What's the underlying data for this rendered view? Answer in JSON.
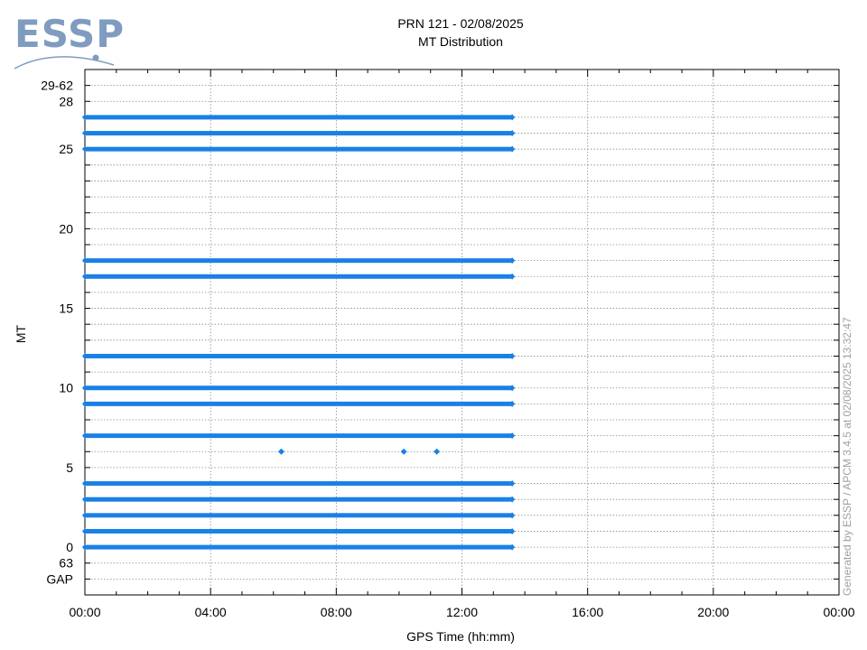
{
  "logo": {
    "text": "ESSP",
    "color": "#7f9cc0"
  },
  "chart_data": {
    "type": "scatter",
    "title": "PRN 121 - 02/08/2025",
    "subtitle": "MT Distribution",
    "xlabel": "GPS Time (hh:mm)",
    "ylabel": "MT",
    "x_ticks": [
      "00:00",
      "04:00",
      "08:00",
      "12:00",
      "16:00",
      "20:00",
      "00:00"
    ],
    "x_range_hours": [
      0,
      24
    ],
    "y_ticks": [
      {
        "label": "GAP",
        "value": -2
      },
      {
        "label": "63",
        "value": -1
      },
      {
        "label": "0",
        "value": 0
      },
      {
        "label": "5",
        "value": 5
      },
      {
        "label": "10",
        "value": 10
      },
      {
        "label": "15",
        "value": 15
      },
      {
        "label": "20",
        "value": 20
      },
      {
        "label": "25",
        "value": 25
      },
      {
        "label": "28",
        "value": 28
      },
      {
        "label": "29-62",
        "value": 29
      }
    ],
    "y_range": [
      -3,
      30
    ],
    "grid": true,
    "marker_color": "#1a80e6",
    "series": [
      {
        "mt": 0,
        "start_hour": 0.0,
        "end_hour": 13.6
      },
      {
        "mt": 1,
        "start_hour": 0.0,
        "end_hour": 13.6
      },
      {
        "mt": 2,
        "start_hour": 0.0,
        "end_hour": 13.6
      },
      {
        "mt": 3,
        "start_hour": 0.0,
        "end_hour": 13.6
      },
      {
        "mt": 4,
        "start_hour": 0.0,
        "end_hour": 13.6
      },
      {
        "mt": 7,
        "start_hour": 0.0,
        "end_hour": 13.6
      },
      {
        "mt": 9,
        "start_hour": 0.0,
        "end_hour": 13.6
      },
      {
        "mt": 10,
        "start_hour": 0.0,
        "end_hour": 13.6
      },
      {
        "mt": 12,
        "start_hour": 0.0,
        "end_hour": 13.6
      },
      {
        "mt": 17,
        "start_hour": 0.0,
        "end_hour": 13.6
      },
      {
        "mt": 18,
        "start_hour": 0.0,
        "end_hour": 13.6
      },
      {
        "mt": 25,
        "start_hour": 0.0,
        "end_hour": 13.6
      },
      {
        "mt": 26,
        "start_hour": 0.0,
        "end_hour": 13.6
      },
      {
        "mt": 27,
        "start_hour": 0.0,
        "end_hour": 13.6
      }
    ],
    "points": [
      {
        "mt": 6,
        "hour": 6.25
      },
      {
        "mt": 6,
        "hour": 10.15
      },
      {
        "mt": 6,
        "hour": 11.2
      }
    ]
  },
  "footer": {
    "generated_text": "Generated by ESSP / APCM 3.4.5 at 02/08/2025 13:32:47"
  }
}
